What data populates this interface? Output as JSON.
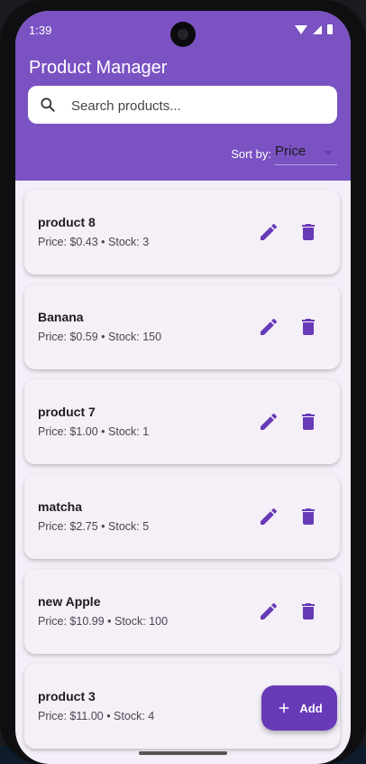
{
  "status_bar": {
    "time": "1:39"
  },
  "header": {
    "title": "Product Manager",
    "search_placeholder": "Search products...",
    "sort_label": "Sort by:",
    "sort_value": "Price"
  },
  "products": [
    {
      "name": "product 8",
      "details": "Price: $0.43 • Stock: 3"
    },
    {
      "name": "Banana",
      "details": "Price: $0.59 • Stock: 150"
    },
    {
      "name": "product 7",
      "details": "Price: $1.00 • Stock: 1"
    },
    {
      "name": "matcha",
      "details": "Price: $2.75 • Stock: 5"
    },
    {
      "name": "new Apple",
      "details": "Price: $10.99 • Stock: 100"
    },
    {
      "name": "product 3",
      "details": "Price: $11.00 • Stock: 4"
    }
  ],
  "fab": {
    "label": "Add"
  },
  "colors": {
    "primary": "#7a52c2",
    "accent": "#673ab7",
    "icon": "#673ab7",
    "card": "#f5eff8"
  },
  "icons": [
    "search-icon",
    "edit-icon",
    "delete-icon",
    "add-icon",
    "wifi-icon",
    "signal-icon",
    "battery-icon"
  ]
}
